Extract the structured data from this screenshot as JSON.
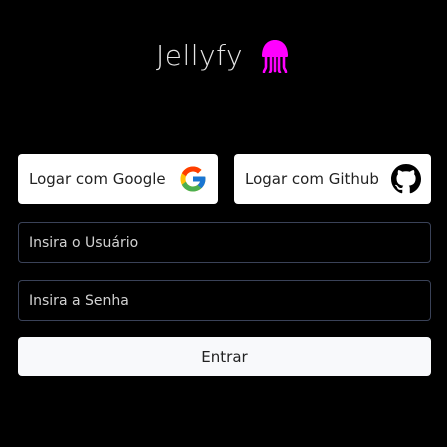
{
  "brand": {
    "title": "Jellyfy",
    "logo_icon": "jellyfish-icon",
    "logo_color": "#ff00ff"
  },
  "oauth": {
    "google": {
      "label": "Logar com Google",
      "icon": "google-icon"
    },
    "github": {
      "label": "Logar com Github",
      "icon": "github-icon"
    }
  },
  "form": {
    "username_placeholder": "Insira o Usuário",
    "password_placeholder": "Insira a Senha",
    "submit_label": "Entrar"
  },
  "colors": {
    "background": "#000000",
    "button_background": "#ffffff",
    "field_border": "#3a4258",
    "accent": "#ff00ff"
  }
}
